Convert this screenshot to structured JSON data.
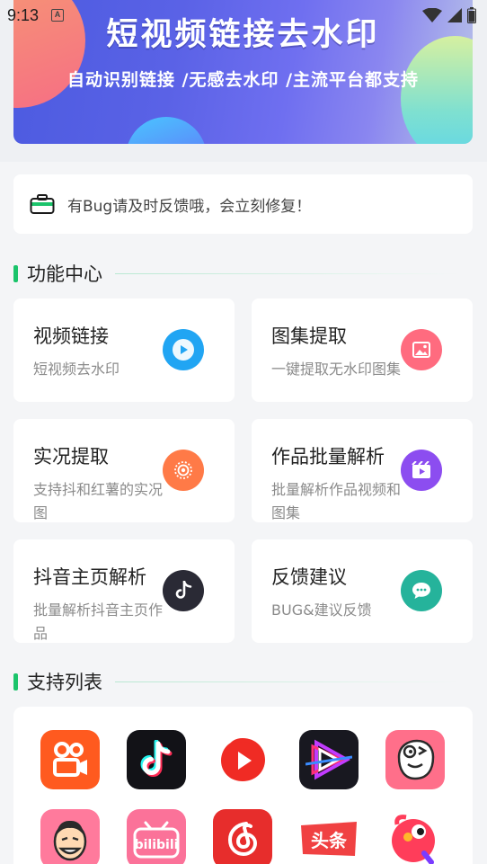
{
  "status_bar": {
    "time": "9:13",
    "a_icon": "A"
  },
  "banner": {
    "title": "短视频链接去水印",
    "subtitle": "自动识别链接 /无感去水印 /主流平台都支持"
  },
  "notice": {
    "text": "有Bug请及时反馈哦，会立刻修复！"
  },
  "sections": {
    "features": "功能中心",
    "support": "支持列表"
  },
  "features": [
    {
      "title": "视频链接",
      "desc": "短视频去水印",
      "icon": "play-icon",
      "color": "#21a5f3"
    },
    {
      "title": "图集提取",
      "desc": "一键提取无水印图集",
      "icon": "image-icon",
      "color": "#ff6b7f"
    },
    {
      "title": "实况提取",
      "desc": "支持抖和红薯的实况图",
      "icon": "live-photo-icon",
      "color": "#ff7a47"
    },
    {
      "title": "作品批量解析",
      "desc": "批量解析作品视频和图集",
      "icon": "batch-video-icon",
      "color": "#8c4df0"
    },
    {
      "title": "抖音主页解析",
      "desc": "批量解析抖音主页作品",
      "icon": "tiktok-icon",
      "color": "#2a2a35"
    },
    {
      "title": "反馈建议",
      "desc": "BUG&建议反馈",
      "icon": "chat-icon",
      "color": "#25b39b"
    }
  ],
  "apps": [
    {
      "name": "kuaishou-app-icon",
      "bg": "#ff5a1f"
    },
    {
      "name": "douyin-app-icon",
      "bg": "#121217"
    },
    {
      "name": "xigua-app-icon",
      "bg": "#ffffff"
    },
    {
      "name": "video-player-app-icon",
      "bg": "#181820"
    },
    {
      "name": "pipixia-app-icon",
      "bg": "#ff6f8a"
    },
    {
      "name": "zuiyou-app-icon",
      "bg": "#ff7a9c"
    },
    {
      "name": "bilibili-app-icon",
      "bg": "#fb7299"
    },
    {
      "name": "netease-music-app-icon",
      "bg": "#e72d2c"
    },
    {
      "name": "toutiao-app-icon",
      "bg": "#ffffff",
      "label": "头条"
    },
    {
      "name": "quanmin-app-icon",
      "bg": "#ffffff"
    }
  ]
}
